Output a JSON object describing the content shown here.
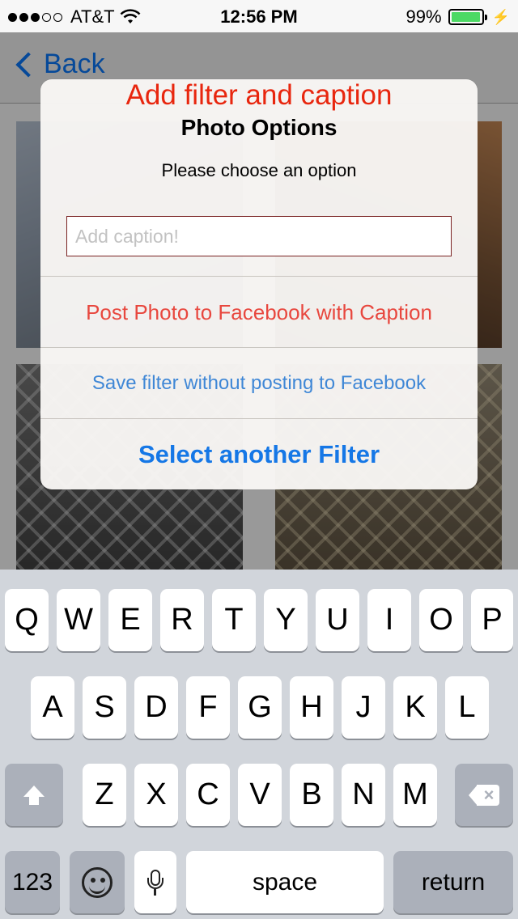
{
  "status_bar": {
    "carrier": "AT&T",
    "time": "12:56 PM",
    "battery_percent": "99%",
    "battery_level": 0.99,
    "signal_bars": 3,
    "signal_total": 5
  },
  "nav": {
    "back_label": "Back",
    "accent": "#0a7aff"
  },
  "alert": {
    "main_title": "Add filter and caption",
    "title": "Photo Options",
    "message": "Please choose an option",
    "caption_placeholder": "Add caption!",
    "caption_value": "",
    "buttons": [
      {
        "label": "Post Photo to Facebook with Caption",
        "color": "#e8473e"
      },
      {
        "label": "Save filter without posting to Facebook",
        "color": "#3f87d6"
      },
      {
        "label": "Select another Filter",
        "color": "#1577e6"
      }
    ]
  },
  "keyboard": {
    "row1": [
      "Q",
      "W",
      "E",
      "R",
      "T",
      "Y",
      "U",
      "I",
      "O",
      "P"
    ],
    "row2": [
      "A",
      "S",
      "D",
      "F",
      "G",
      "H",
      "J",
      "K",
      "L"
    ],
    "row3": [
      "Z",
      "X",
      "C",
      "V",
      "B",
      "N",
      "M"
    ],
    "numbers_label": "123",
    "space_label": "space",
    "return_label": "return",
    "icons": {
      "shift": "shift-icon",
      "delete": "delete-icon",
      "emoji": "emoji-icon",
      "dictation": "microphone-icon"
    }
  }
}
